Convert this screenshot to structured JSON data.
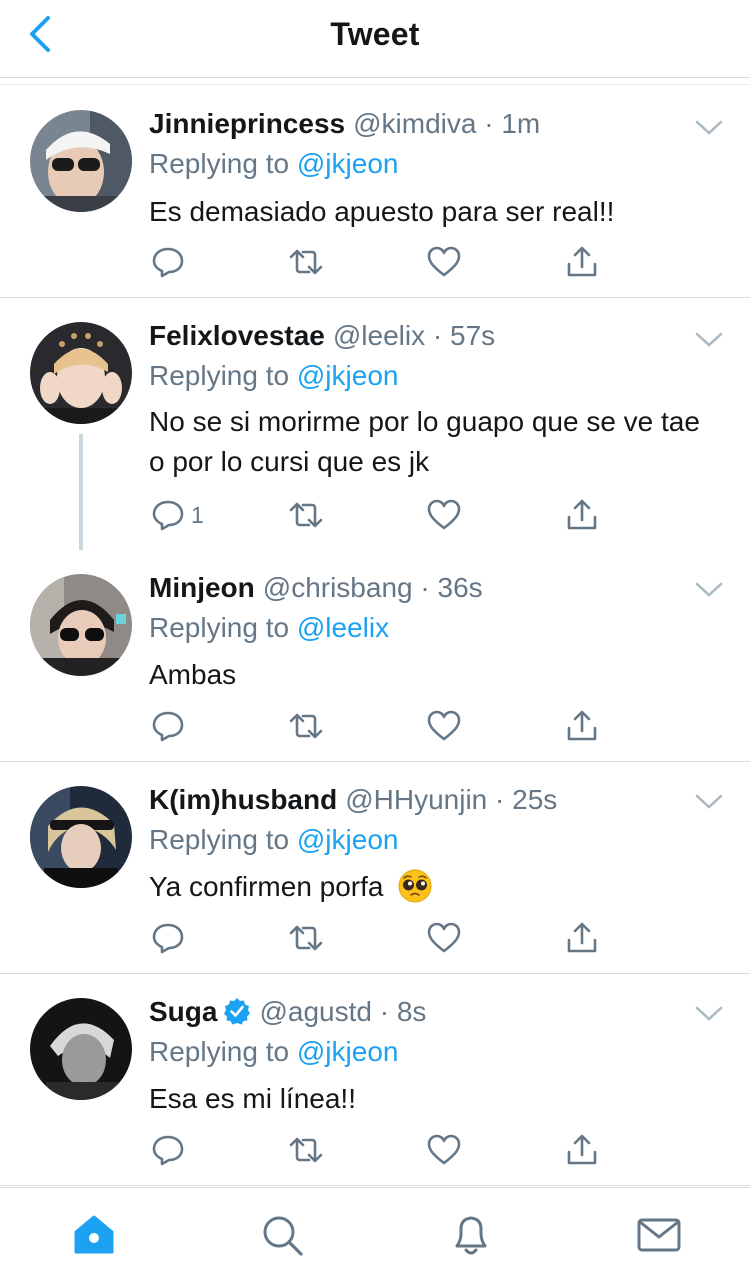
{
  "header": {
    "title": "Tweet"
  },
  "tweets": [
    {
      "name": "Jinnieprincess",
      "handle": "@kimdiva",
      "time": "1m",
      "replying_prefix": "Replying to",
      "replying_to": "@jkjeon",
      "text": "Es demasiado apuesto para ser real!!",
      "reply_count": ""
    },
    {
      "name": "Felixlovestae",
      "handle": "@leelix",
      "time": "57s",
      "replying_prefix": "Replying to",
      "replying_to": "@jkjeon",
      "text": "No se si morirme por lo guapo que se ve tae o por lo cursi que es jk",
      "reply_count": "1"
    },
    {
      "name": "Minjeon",
      "handle": "@chrisbang",
      "time": "36s",
      "replying_prefix": "Replying to",
      "replying_to": "@leelix",
      "text": "Ambas",
      "reply_count": ""
    },
    {
      "name": "K(im)husband",
      "handle": "@HHyunjin",
      "time": "25s",
      "replying_prefix": "Replying to",
      "replying_to": "@jkjeon",
      "text": "Ya confirmen porfa",
      "emoji": "pleading-face",
      "reply_count": ""
    },
    {
      "name": "Suga",
      "handle": "@agustd",
      "time": "8s",
      "replying_prefix": "Replying to",
      "replying_to": "@jkjeon",
      "text": "Esa es mi línea!!",
      "verified": true,
      "reply_count": ""
    }
  ],
  "tabbar": {
    "items": [
      "home-icon",
      "search-icon",
      "notifications-icon",
      "messages-icon"
    ],
    "active": "home-icon"
  },
  "colors": {
    "accent": "#1da1f2",
    "muted": "#657786",
    "text": "#14171a",
    "divider": "#d6dbdf"
  }
}
